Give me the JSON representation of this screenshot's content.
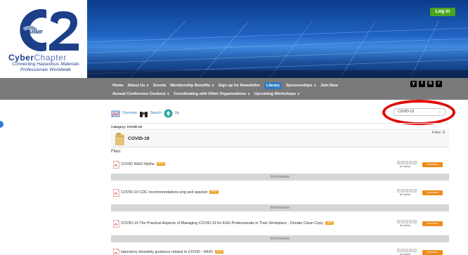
{
  "header": {
    "logo_org": "AHMP",
    "logo_main": "C2",
    "logo_cyber": "Cyber",
    "logo_chapter": "Chapter",
    "logo_tagline": "Connecting Hazardous Materials Professionals Worldwide",
    "login_label": "Log In"
  },
  "nav": {
    "row1": [
      {
        "label": "Home",
        "chevron": false,
        "active": false
      },
      {
        "label": "About Us",
        "chevron": true,
        "active": false
      },
      {
        "label": "Events",
        "chevron": false,
        "active": false
      },
      {
        "label": "Membership Benefits",
        "chevron": true,
        "active": false
      },
      {
        "label": "Sign up for Newsletter",
        "chevron": false,
        "active": false
      },
      {
        "label": "Library",
        "chevron": false,
        "active": true
      },
      {
        "label": "Sponsorships",
        "chevron": true,
        "active": false
      },
      {
        "label": "Join Now",
        "chevron": false,
        "active": false
      }
    ],
    "row2": [
      {
        "label": "Annual Conference Cookout",
        "chevron": true,
        "active": false
      },
      {
        "label": "Coordinating with Other Organizations",
        "chevron": true,
        "active": false
      },
      {
        "label": "Upcoming Workshops",
        "chevron": true,
        "active": false
      }
    ],
    "social": [
      "y",
      "f",
      "G",
      "r"
    ]
  },
  "toolbar": {
    "overview_label": "Overview",
    "search_label": "Search",
    "up_label": "Up"
  },
  "category_select": {
    "selected": "COVID-19"
  },
  "category": {
    "breadcrumb": "Category: COVID-19",
    "title": "COVID-19",
    "files_count": "Files: 9",
    "files_label": "Files:"
  },
  "files": [
    {
      "name": "COVID WHO Myths",
      "badge": "NEW",
      "votes": "(0 votes)",
      "download": "Download"
    },
    {
      "name": "COVID-19 CDC recommendations eng and spanish",
      "badge": "NEW",
      "votes": "(0 votes)",
      "download": "Download"
    },
    {
      "name": "COVID-19 The Practical Aspects of Managing COVID-19 for EHS Professionals in Their Workplace - Donato Clean Copy",
      "badge": "NEW",
      "votes": "(0 votes)",
      "download": "Download"
    },
    {
      "name": "laboratory biosafety guidance related to COVID - WHO",
      "badge": "NEW",
      "votes": "(0 votes)",
      "download": "Download"
    }
  ],
  "info_label": "Information",
  "colors": {
    "nav_bg": "#7a7a7a",
    "active_nav": "#2f7bbf",
    "download": "#f08a1a",
    "badge": "#f0a020",
    "login": "#4aa520",
    "highlight": "#e00a0a"
  }
}
